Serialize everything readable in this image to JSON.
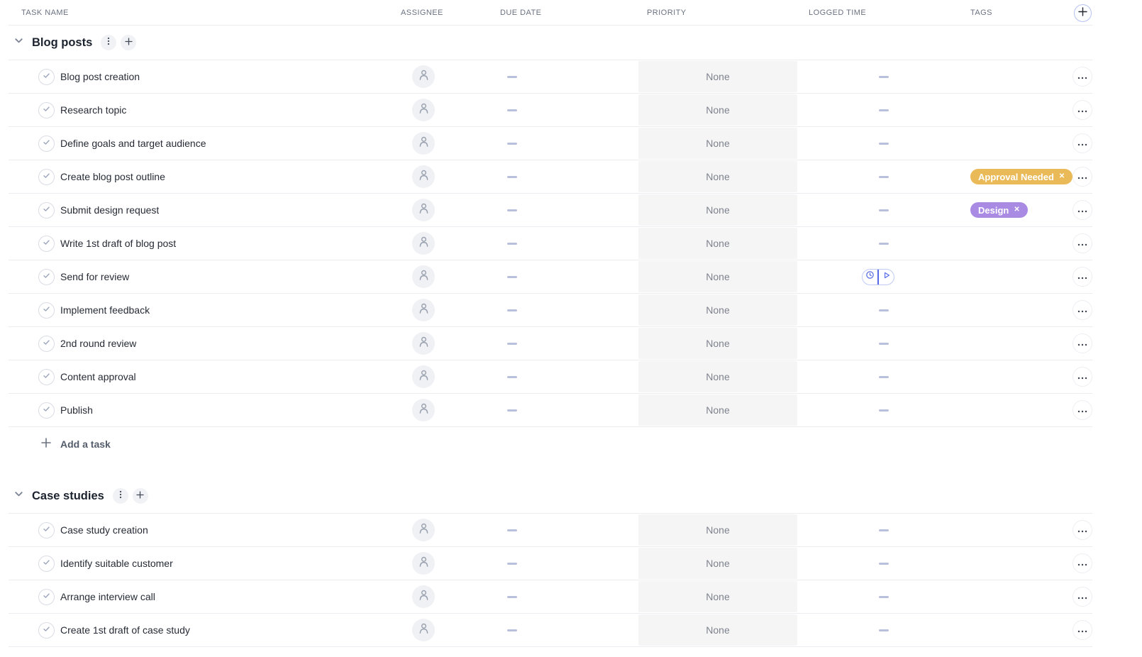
{
  "table": {
    "columns": [
      "TASK NAME",
      "ASSIGNEE",
      "DUE DATE",
      "PRIORITY",
      "LOGGED TIME",
      "TAGS"
    ]
  },
  "groups": [
    {
      "name": "Blog posts",
      "add_task_label": "Add a task",
      "tasks": [
        {
          "name": "Blog post creation",
          "priority": "None"
        },
        {
          "name": "Research topic",
          "priority": "None"
        },
        {
          "name": "Define goals and target audience",
          "priority": "None"
        },
        {
          "name": "Create blog post outline",
          "priority": "None",
          "tags": [
            {
              "label": "Approval Needed",
              "color": "#e9ba57"
            }
          ]
        },
        {
          "name": "Submit design request",
          "priority": "None",
          "tags": [
            {
              "label": "Design",
              "color": "#a98be3"
            }
          ]
        },
        {
          "name": "Write 1st draft of blog post",
          "priority": "None"
        },
        {
          "name": "Send for review",
          "priority": "None",
          "timer_visible": true
        },
        {
          "name": "Implement feedback",
          "priority": "None"
        },
        {
          "name": "2nd round review",
          "priority": "None"
        },
        {
          "name": "Content approval",
          "priority": "None"
        },
        {
          "name": "Publish",
          "priority": "None"
        }
      ]
    },
    {
      "name": "Case studies",
      "tasks": [
        {
          "name": "Case study creation",
          "priority": "None"
        },
        {
          "name": "Identify suitable customer",
          "priority": "None"
        },
        {
          "name": "Arrange interview call",
          "priority": "None"
        },
        {
          "name": "Create 1st draft of case study",
          "priority": "None"
        }
      ]
    }
  ],
  "icons": {
    "group_collapse": "chevron-down",
    "group_menu": "vertical-ellipsis",
    "group_add": "plus",
    "task_status": "check-circle",
    "assignee_placeholder": "person",
    "empty_value": "dash",
    "timer_left": "clock",
    "timer_right": "play",
    "tag_remove": "x",
    "row_menu": "horizontal-ellipsis",
    "add_column": "plus"
  },
  "colors": {
    "accent_blue": "#5468e6",
    "priority_cell_bg": "#f5f5f6",
    "tag_approval_needed": "#e9ba57",
    "tag_design": "#a98be3",
    "empty_dash": "#b8c0db"
  }
}
